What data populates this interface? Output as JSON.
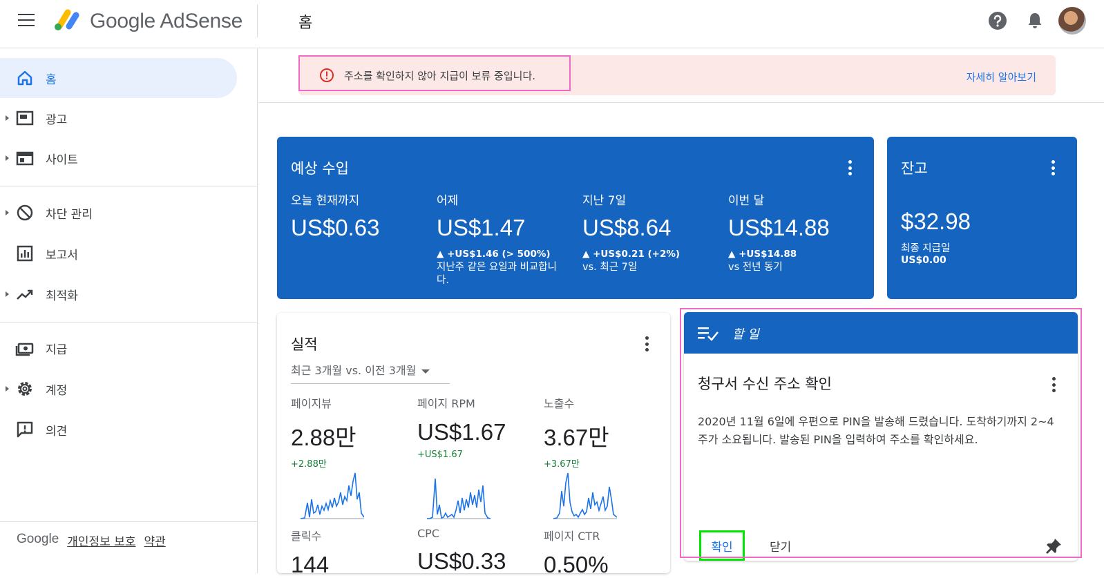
{
  "header": {
    "brand": "Google AdSense",
    "page_title": "홈"
  },
  "sidebar": {
    "items": [
      {
        "label": "홈",
        "icon": "home-icon",
        "active": true
      },
      {
        "label": "광고",
        "icon": "ads-icon"
      },
      {
        "label": "사이트",
        "icon": "sites-icon"
      },
      {
        "label": "차단 관리",
        "icon": "block-icon"
      },
      {
        "label": "보고서",
        "icon": "reports-icon"
      },
      {
        "label": "최적화",
        "icon": "optimization-icon"
      },
      {
        "label": "지급",
        "icon": "payments-icon"
      },
      {
        "label": "계정",
        "icon": "gear-icon"
      },
      {
        "label": "의견",
        "icon": "feedback-icon"
      }
    ],
    "footer": {
      "brand": "Google",
      "privacy": "개인정보 보호",
      "terms": "약관"
    }
  },
  "alert": {
    "message": "주소를 확인하지 않아 지급이 보류 중입니다.",
    "link": "자세히 알아보기"
  },
  "earnings": {
    "title": "예상 수입",
    "metrics": [
      {
        "label": "오늘 현재까지",
        "value": "US$0.63",
        "change": "",
        "compare": ""
      },
      {
        "label": "어제",
        "value": "US$1.47",
        "change": "▲ +US$1.46 (> 500%)",
        "compare": "지난주 같은 요일과 비교합니다."
      },
      {
        "label": "지난 7일",
        "value": "US$8.64",
        "change": "▲ +US$0.21 (+2%)",
        "compare": "vs. 최근 7일"
      },
      {
        "label": "이번 달",
        "value": "US$14.88",
        "change": "▲ +US$14.88",
        "compare": "vs 전년 동기"
      }
    ]
  },
  "balance": {
    "title": "잔고",
    "value": "$32.98",
    "last_payment_label": "최종 지급일",
    "last_payment_value": "US$0.00"
  },
  "performance": {
    "title": "실적",
    "range": "최근 3개월 vs. 이전 3개월",
    "metrics": [
      {
        "label": "페이지뷰",
        "value": "2.88만",
        "delta": "+2.88만"
      },
      {
        "label": "페이지 RPM",
        "value": "US$1.67",
        "delta": "+US$1.67"
      },
      {
        "label": "노출수",
        "value": "3.67만",
        "delta": "+3.67만"
      },
      {
        "label": "클릭수",
        "value": "144"
      },
      {
        "label": "CPC",
        "value": "US$0.33"
      },
      {
        "label": "페이지 CTR",
        "value": "0.50%"
      }
    ]
  },
  "todo": {
    "header": "할 일",
    "title": "청구서 수신 주소 확인",
    "body": "2020년 11월 6일에 우편으로 PIN을 발송해 드렸습니다. 도착하기까지 2~4주가 소요됩니다. 발송된 PIN을 입력하여 주소를 확인하세요.",
    "confirm": "확인",
    "close": "닫기"
  },
  "colors": {
    "primary": "#1565c0",
    "link": "#1a73e8",
    "alert_bg": "#fce8e6",
    "positive": "#188038",
    "annotation_pink": "#f06ac5",
    "annotation_green": "#00e600"
  }
}
